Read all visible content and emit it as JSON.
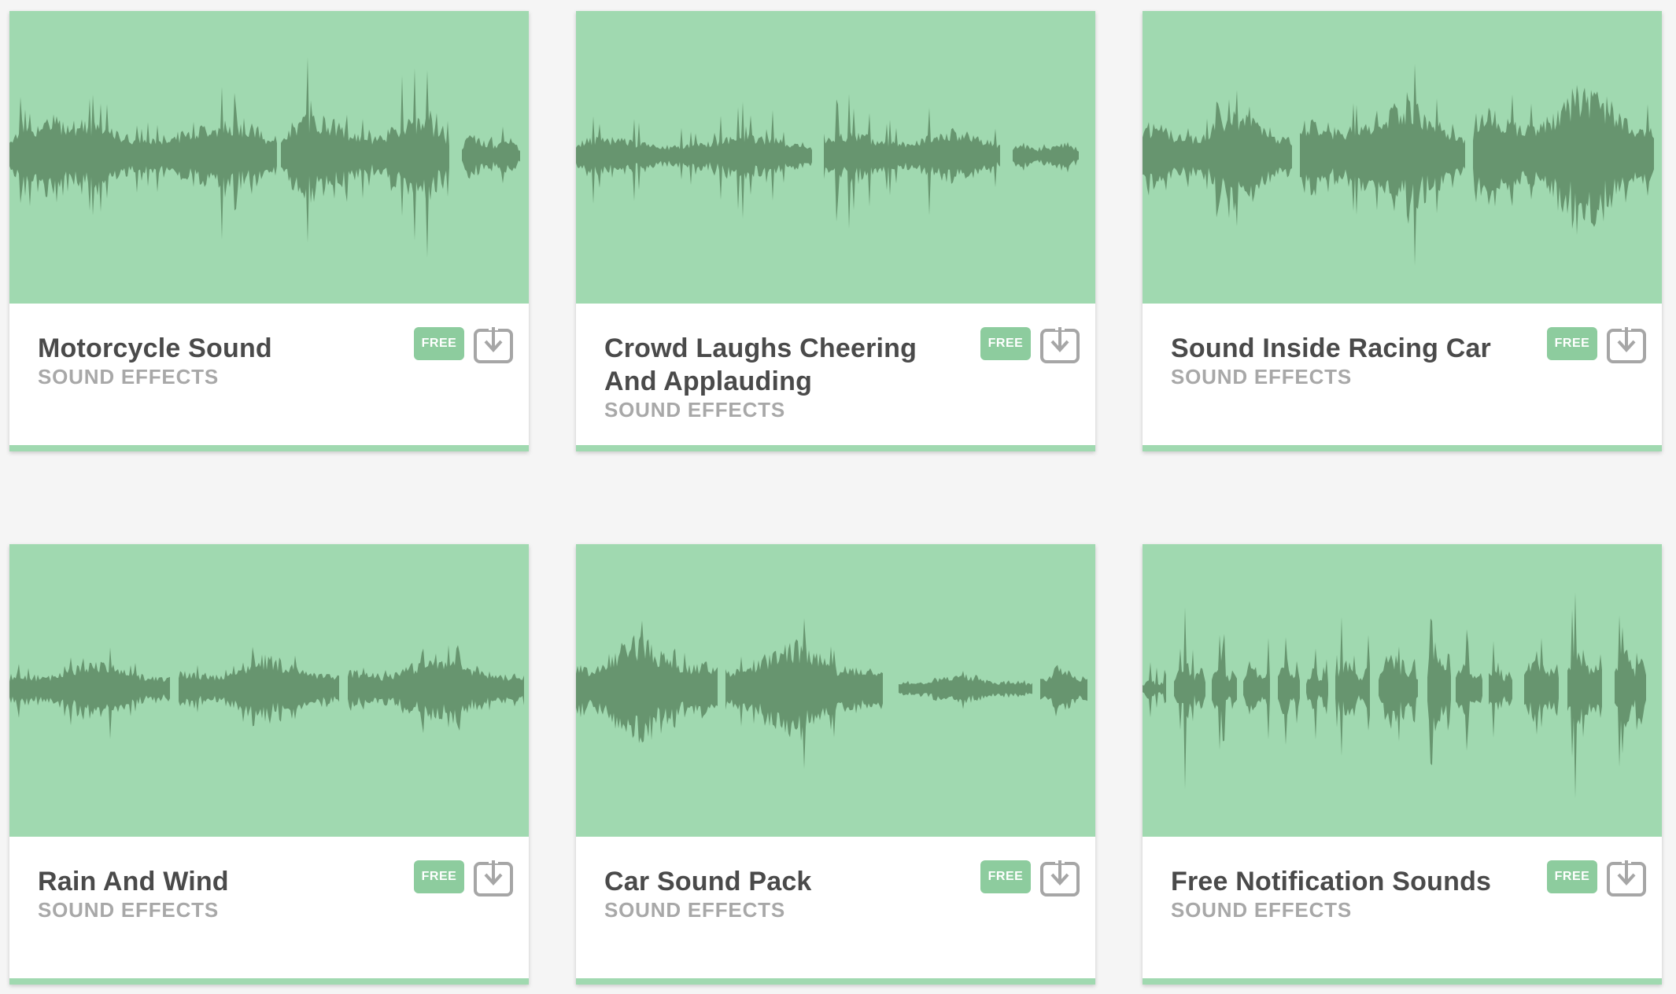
{
  "colors": {
    "thumb_bg": "#a0d9b0",
    "waveform": "#67956f",
    "badge_bg": "#8dcc9e",
    "page_bg": "#f5f5f5"
  },
  "icons": {
    "download": "download-icon"
  },
  "cards": [
    {
      "title": "Motorcycle Sound",
      "category": "SOUND EFFECTS",
      "badge": "FREE"
    },
    {
      "title": "Crowd Laughs Cheering And Applauding",
      "category": "SOUND EFFECTS",
      "badge": "FREE"
    },
    {
      "title": "Sound Inside Racing Car",
      "category": "SOUND EFFECTS",
      "badge": "FREE"
    },
    {
      "title": "Rain And Wind",
      "category": "SOUND EFFECTS",
      "badge": "FREE"
    },
    {
      "title": "Car Sound Pack",
      "category": "SOUND EFFECTS",
      "badge": "FREE"
    },
    {
      "title": "Free Notification Sounds",
      "category": "SOUND EFFECTS",
      "badge": "FREE"
    }
  ]
}
